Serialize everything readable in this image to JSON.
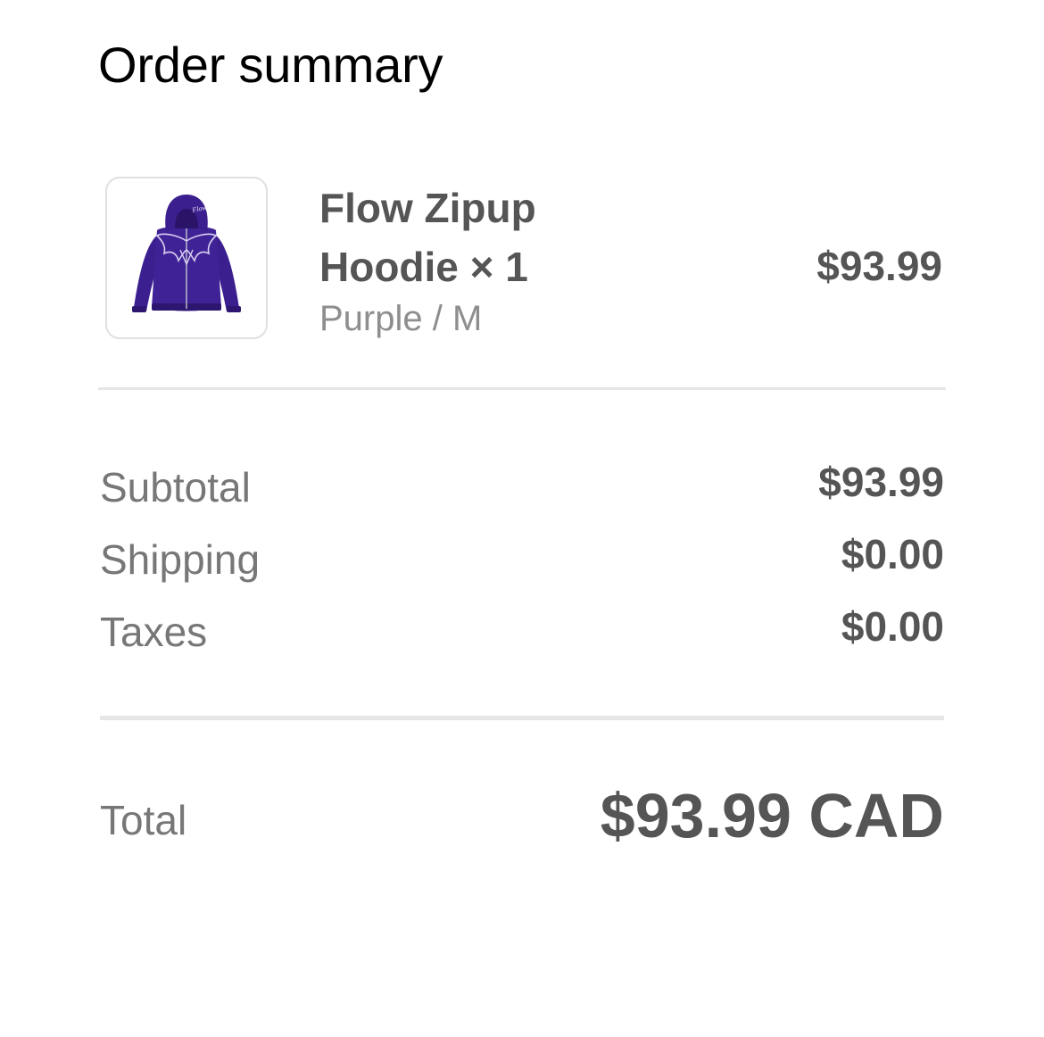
{
  "header": {
    "title": "Order summary"
  },
  "line_item": {
    "name": "Flow Zipup Hoodie × 1",
    "variant": "Purple / M",
    "price": "$93.99",
    "thumbnail_logo_text": "Flow",
    "thumbnail_color": "#3b1f8f"
  },
  "summary": {
    "rows": [
      {
        "label": "Subtotal",
        "value": "$93.99"
      },
      {
        "label": "Shipping",
        "value": "$0.00"
      },
      {
        "label": "Taxes",
        "value": "$0.00"
      }
    ]
  },
  "total": {
    "label": "Total",
    "value": "$93.99 CAD"
  },
  "colors": {
    "text_primary": "#000000",
    "text_strong": "#555555",
    "text_muted": "#777777",
    "text_variant": "#8e8e8e",
    "divider": "#e6e6e6"
  }
}
